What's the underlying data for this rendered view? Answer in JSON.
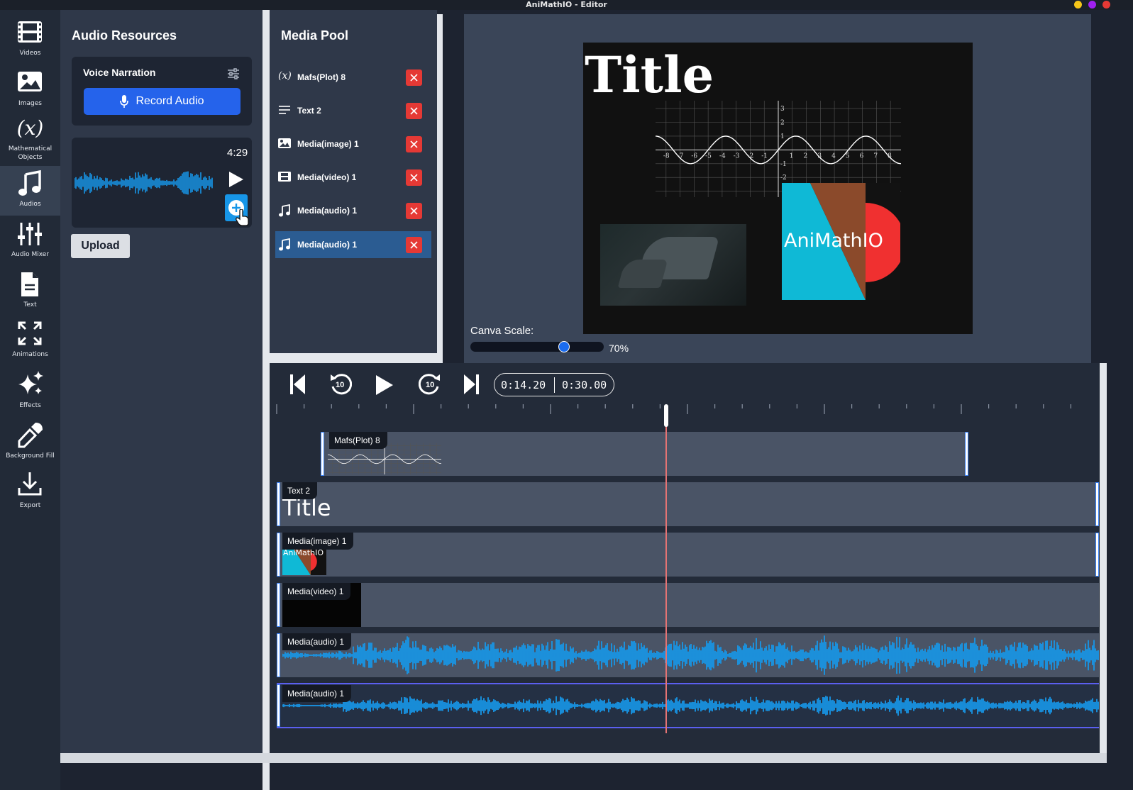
{
  "window": {
    "title": "AniMathIO - Editor",
    "dots": [
      "#f5c518",
      "#a020f0",
      "#e53935"
    ]
  },
  "sidebar": {
    "items": [
      {
        "label": "Videos",
        "icon": "film-icon"
      },
      {
        "label": "Images",
        "icon": "image-icon"
      },
      {
        "label": "Mathematical Objects",
        "icon": "math-fx-icon"
      },
      {
        "label": "Audios",
        "icon": "music-note-icon",
        "active": true
      },
      {
        "label": "Audio Mixer",
        "icon": "mixer-sliders-icon"
      },
      {
        "label": "Text",
        "icon": "text-file-icon"
      },
      {
        "label": "Animations",
        "icon": "expand-arrows-icon"
      },
      {
        "label": "Effects",
        "icon": "sparkles-icon"
      },
      {
        "label": "Background Fill",
        "icon": "eyedropper-icon"
      },
      {
        "label": "Export",
        "icon": "download-icon"
      }
    ]
  },
  "audio_panel": {
    "title": "Audio Resources",
    "voice_narration": "Voice Narration",
    "record_label": "Record Audio",
    "clip_duration": "4:29",
    "upload_label": "Upload"
  },
  "media_pool": {
    "title": "Media Pool",
    "items": [
      {
        "label": "Mafs(Plot) 8",
        "icon": "math-fx-icon"
      },
      {
        "label": "Text 2",
        "icon": "text-lines-icon"
      },
      {
        "label": "Media(image) 1",
        "icon": "image-icon"
      },
      {
        "label": "Media(video) 1",
        "icon": "film-icon"
      },
      {
        "label": "Media(audio) 1",
        "icon": "music-note-icon"
      },
      {
        "label": "Media(audio) 1",
        "icon": "music-note-icon",
        "selected": true
      }
    ]
  },
  "preview": {
    "title_text": "Title",
    "logo_text": "AniMathIO",
    "scale_label": "Canva Scale:",
    "scale_value": "70%",
    "scale_fraction": 0.7,
    "plot_x_ticks": [
      "-8",
      "-7",
      "-6",
      "-5",
      "-4",
      "-3",
      "-2",
      "-1",
      "1",
      "2",
      "3",
      "4",
      "5",
      "6",
      "7",
      "8"
    ],
    "plot_y_ticks": [
      "3",
      "2",
      "1",
      "-1",
      "-2"
    ]
  },
  "transport": {
    "current_time": "0:14.20",
    "total_time": "0:30.00",
    "playhead_fraction": 0.4733
  },
  "tracks": [
    {
      "label": "Mafs(Plot) 8",
      "thumb_text": ""
    },
    {
      "label": "Text 2",
      "thumb_text": "Title"
    },
    {
      "label": "Media(image) 1",
      "thumb_text": "AniMathIO"
    },
    {
      "label": "Media(video) 1",
      "thumb_text": ""
    },
    {
      "label": "Media(audio) 1",
      "thumb_text": ""
    },
    {
      "label": "Media(audio) 1",
      "thumb_text": ""
    }
  ],
  "colors": {
    "accent": "#2563eb",
    "waveform": "#1796e8",
    "delete": "#e53935",
    "playhead": "#e57373",
    "logo_cyan": "#0fb9d6",
    "logo_brown": "#8b4a2b",
    "logo_red": "#f03030"
  }
}
